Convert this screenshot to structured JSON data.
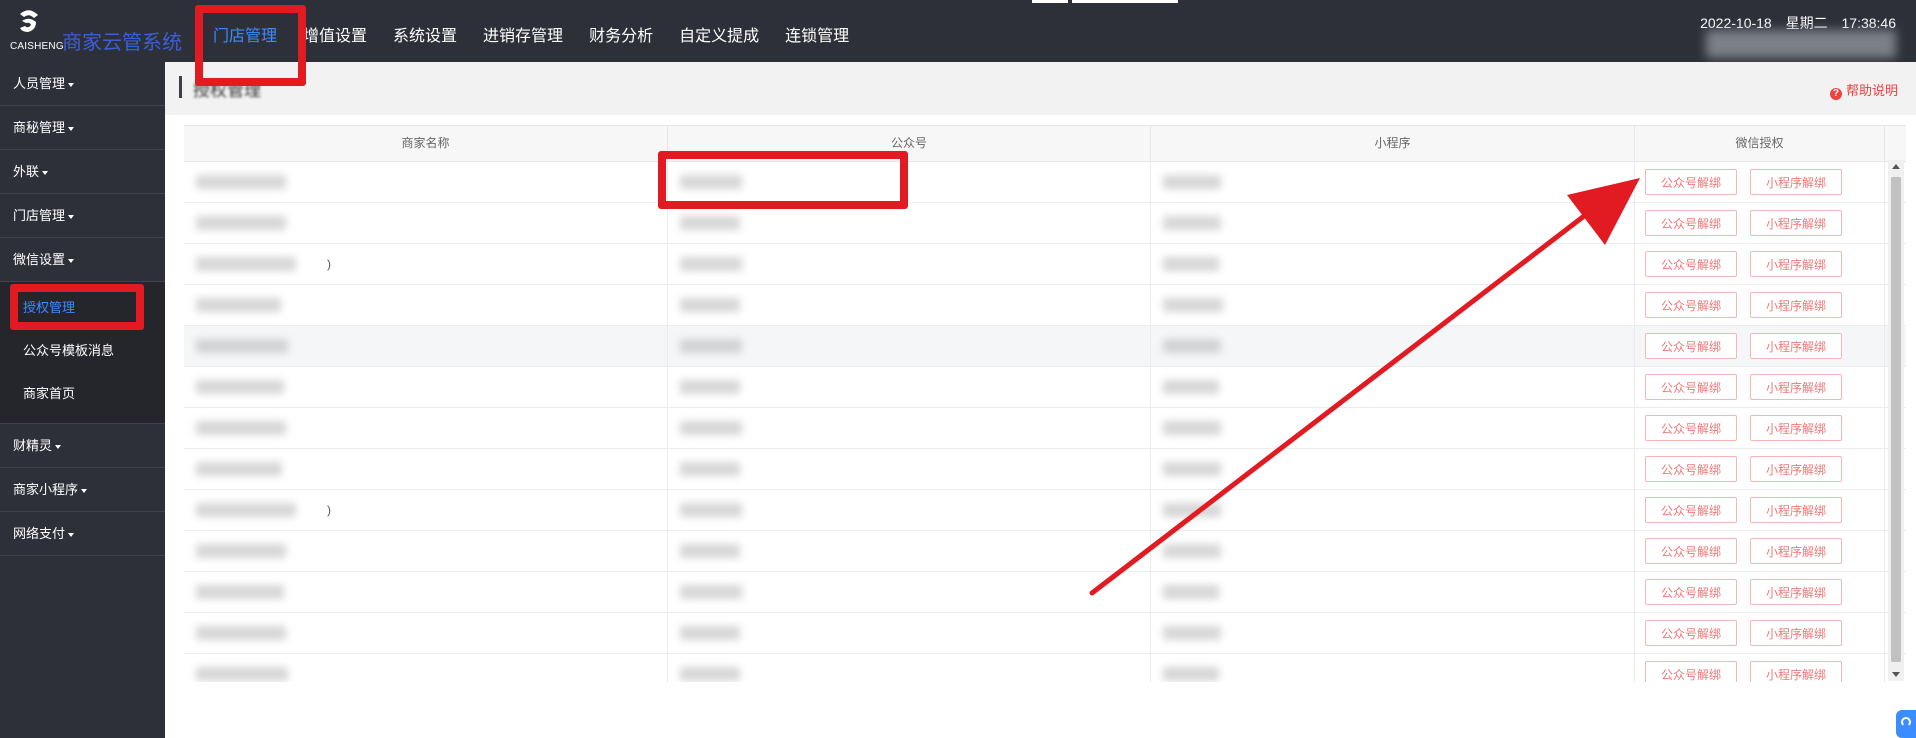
{
  "topbar": {
    "logo_text": "CAISHENG",
    "app_title": "商家云管系统",
    "nav": [
      {
        "label": "门店管理",
        "active": true
      },
      {
        "label": "增值设置"
      },
      {
        "label": "系统设置"
      },
      {
        "label": "进销存管理"
      },
      {
        "label": "财务分析"
      },
      {
        "label": "自定义提成"
      },
      {
        "label": "连锁管理"
      }
    ],
    "datetime": "2022-10-18 星期二 17:38:46"
  },
  "sidebar": {
    "menu": [
      {
        "label": "人员管理"
      },
      {
        "label": "商秘管理"
      },
      {
        "label": "外联"
      },
      {
        "label": "门店管理"
      },
      {
        "label": "微信设置",
        "expanded": true,
        "children": [
          {
            "label": "授权管理",
            "active": true
          },
          {
            "label": "公众号模板消息"
          },
          {
            "label": "商家首页"
          }
        ]
      },
      {
        "label": "财精灵"
      },
      {
        "label": "商家小程序"
      },
      {
        "label": "网络支付"
      }
    ]
  },
  "content": {
    "header_title": "授权管理",
    "help_label": "帮助说明"
  },
  "table": {
    "columns": [
      "商家名称",
      "公众号",
      "小程序",
      "微信授权"
    ],
    "unbind_official_label": "公众号解绑",
    "unbind_mini_label": "小程序解绑",
    "rows": [
      {
        "tail": ""
      },
      {
        "tail": ""
      },
      {
        "tail": ")"
      },
      {
        "tail": ""
      },
      {
        "tail": "",
        "highlighted": true
      },
      {
        "tail": ""
      },
      {
        "tail": ""
      },
      {
        "tail": ""
      },
      {
        "tail": ")"
      },
      {
        "tail": ""
      },
      {
        "tail": ""
      },
      {
        "tail": ""
      },
      {
        "tail": ""
      }
    ]
  },
  "colors": {
    "dark_bg": "#2e3039",
    "accent_blue": "#3b8cff",
    "annotation_red": "#e21b23",
    "button_red": "#f07878"
  }
}
